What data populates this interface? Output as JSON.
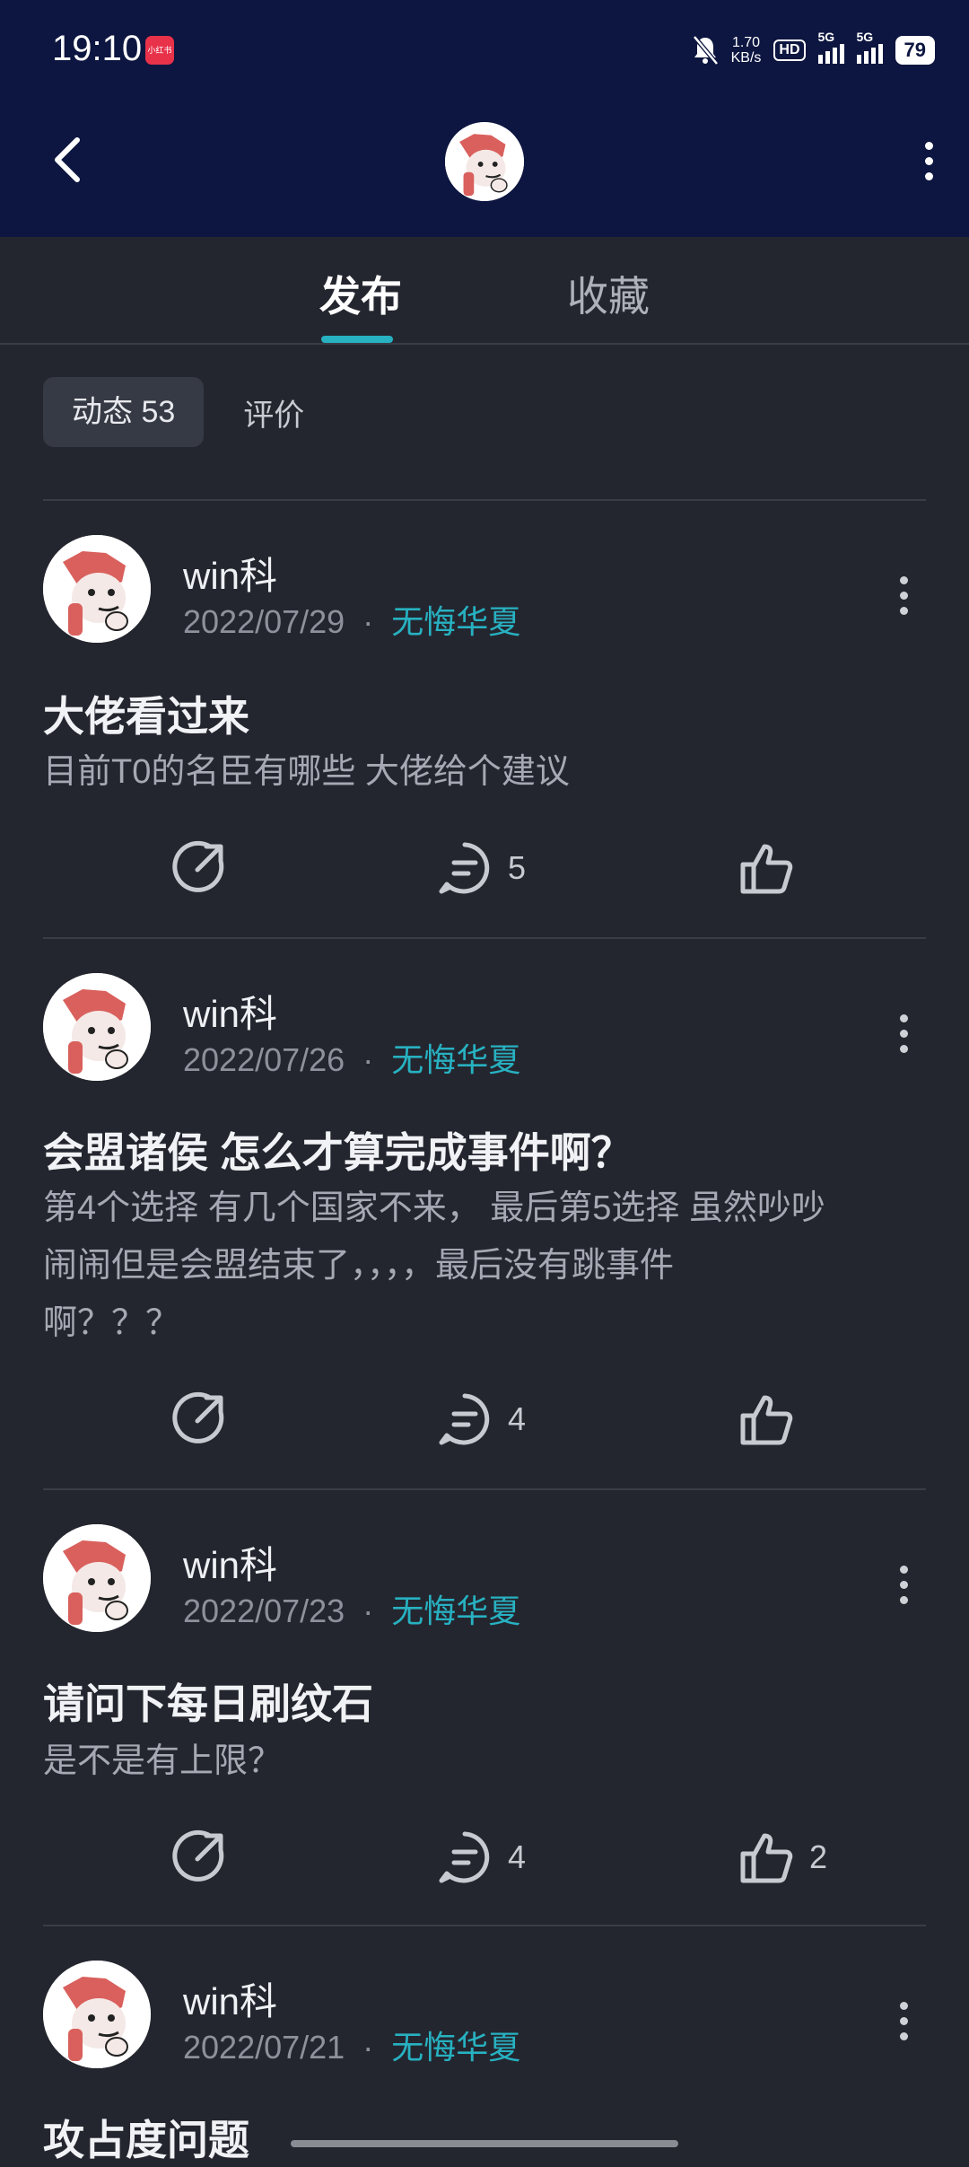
{
  "status_bar": {
    "time": "19:10",
    "app_badge": "小红书",
    "net_speed_value": "1.70",
    "net_speed_unit": "KB/s",
    "hd_label": "HD",
    "sig1_label": "5G",
    "sig2_label": "5G",
    "battery": "79"
  },
  "header": {
    "back_icon": "chevron-left-icon",
    "more_icon": "more-vertical-icon"
  },
  "tabs": [
    {
      "label": "发布",
      "active": true
    },
    {
      "label": "收藏",
      "active": false
    }
  ],
  "subtabs": [
    {
      "label": "动态 53",
      "active": true
    },
    {
      "label": "评价",
      "active": false
    }
  ],
  "posts": [
    {
      "author": "win科",
      "date": "2022/07/29",
      "game": "无悔华夏",
      "title": "大佬看过来",
      "body": "目前T0的名臣有哪些 大佬给个建议",
      "comments": "5",
      "likes": ""
    },
    {
      "author": "win科",
      "date": "2022/07/26",
      "game": "无悔华夏",
      "title": "会盟诸侯 怎么才算完成事件啊？",
      "body_lines": [
        "第4个选择 有几个国家不来， 最后第5选择 虽然吵吵",
        "闹闹但是会盟结束了，，，，最后没有跳事件",
        "啊？？？"
      ],
      "comments": "4",
      "likes": ""
    },
    {
      "author": "win科",
      "date": "2022/07/23",
      "game": "无悔华夏",
      "title": "请问下每日刷纹石",
      "body": "是不是有上限？",
      "comments": "4",
      "likes": "2"
    },
    {
      "author": "win科",
      "date": "2022/07/21",
      "game": "无悔华夏",
      "title": "攻占度问题"
    }
  ],
  "colors": {
    "accent": "#27b1c1",
    "header_bg": "#0d1640",
    "page_bg": "#24262f"
  }
}
